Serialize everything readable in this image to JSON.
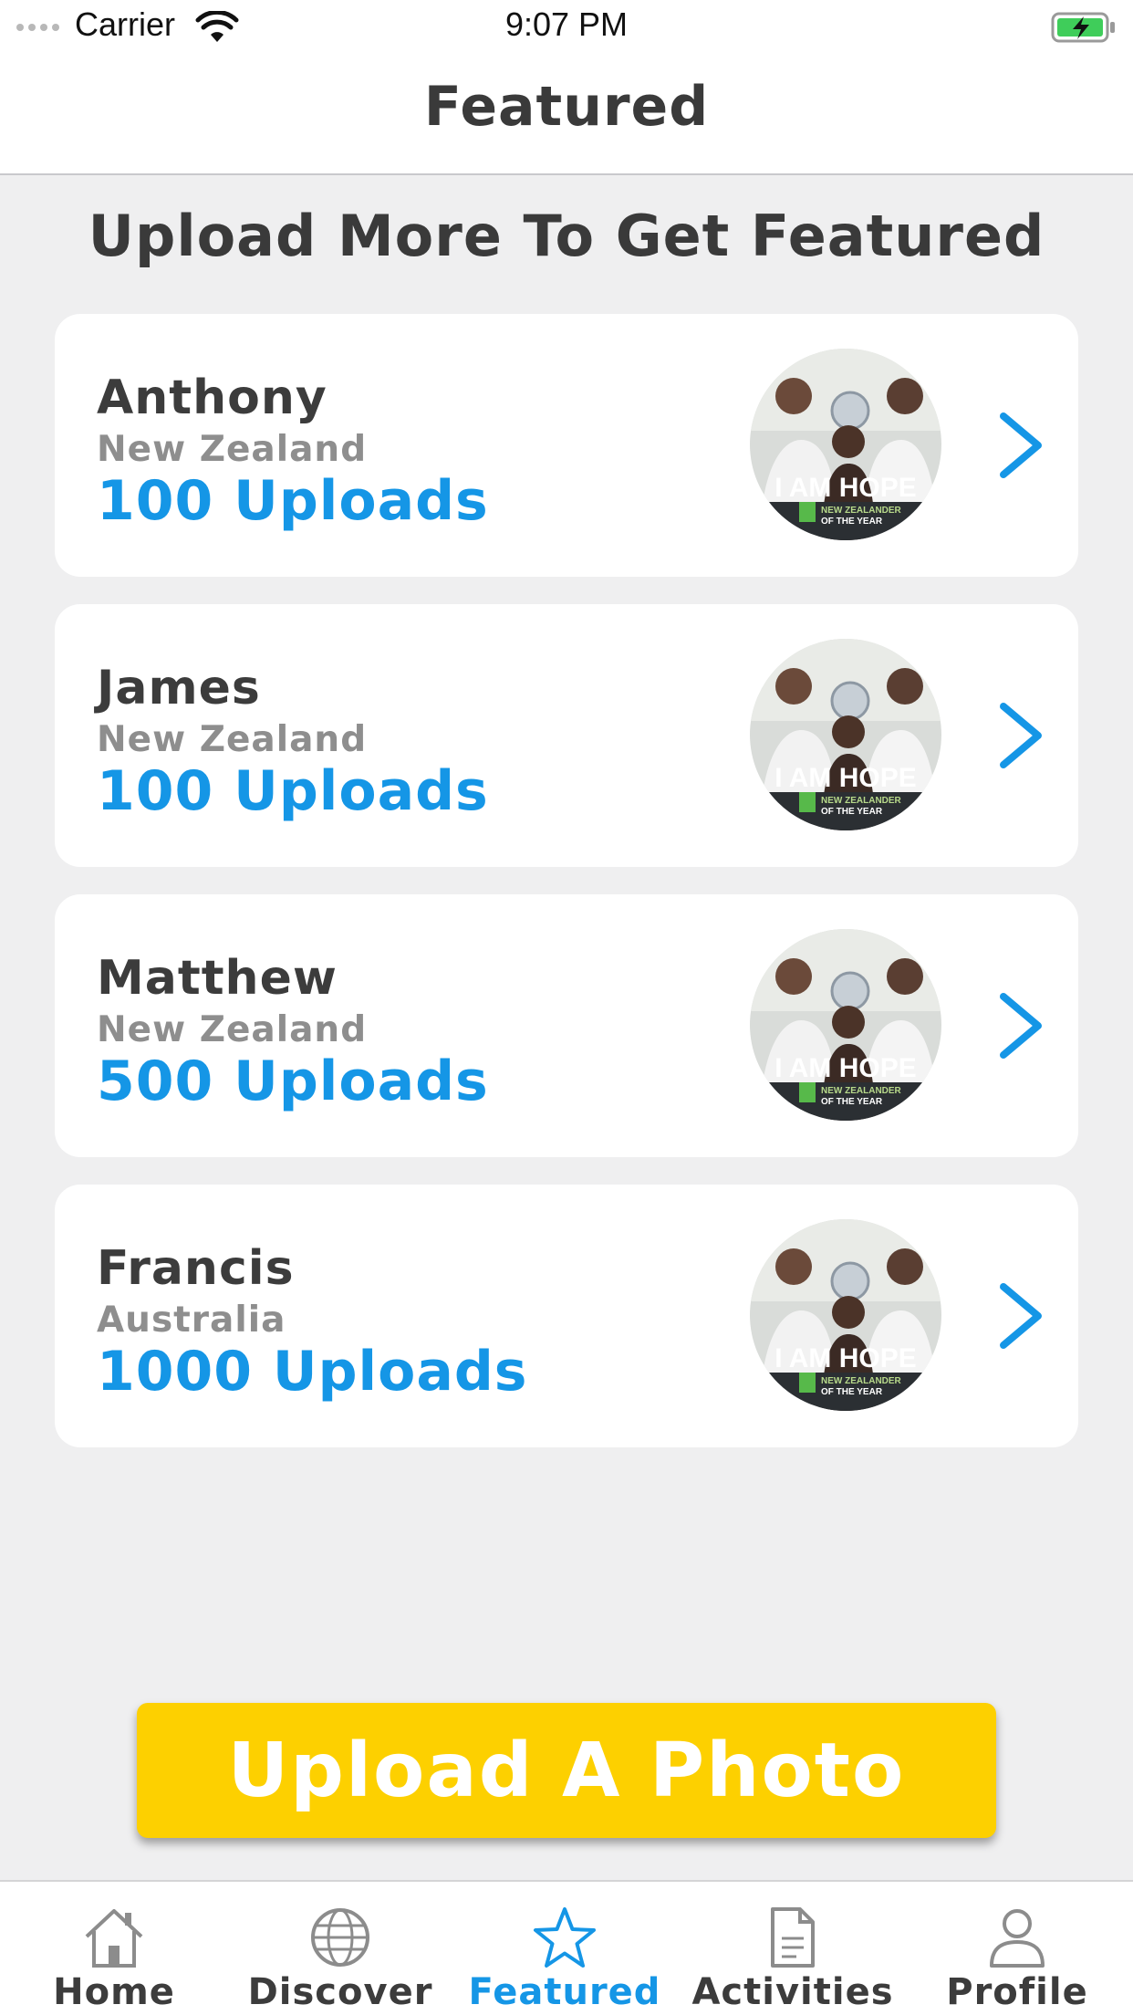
{
  "status_bar": {
    "carrier": "Carrier",
    "time": "9:07 PM"
  },
  "header": {
    "title": "Featured"
  },
  "main": {
    "heading": "Upload More To Get Featured",
    "cards": [
      {
        "name": "Anthony",
        "country": "New Zealand",
        "uploads": "100 Uploads"
      },
      {
        "name": "James",
        "country": "New Zealand",
        "uploads": "100 Uploads"
      },
      {
        "name": "Matthew",
        "country": "New Zealand",
        "uploads": "500 Uploads"
      },
      {
        "name": "Francis",
        "country": "Australia",
        "uploads": "1000 Uploads"
      }
    ],
    "avatar_image": {
      "banner_text": "I AM HOPE",
      "caption_line1": "NEW ZEALANDER",
      "caption_line2": "OF THE YEAR"
    },
    "upload_button": "Upload A Photo"
  },
  "tabs": [
    {
      "label": "Home",
      "icon": "home-icon",
      "active": false
    },
    {
      "label": "Discover",
      "icon": "globe-icon",
      "active": false
    },
    {
      "label": "Featured",
      "icon": "star-icon",
      "active": true
    },
    {
      "label": "Activities",
      "icon": "document-icon",
      "active": false
    },
    {
      "label": "Profile",
      "icon": "person-icon",
      "active": false
    }
  ],
  "colors": {
    "accent": "#1596e6",
    "button": "#fdd000",
    "background": "#efeff0",
    "text": "#3c3c3c",
    "muted": "#8e8e8e"
  }
}
